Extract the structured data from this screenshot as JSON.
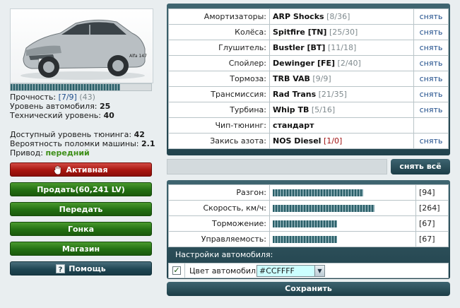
{
  "car": {
    "badge_text": "Alfa 147",
    "durability_label": "Прочность:",
    "durability_value": "[7/9]",
    "durability_extra": "(43)",
    "durability_fraction": 0.78,
    "level_label": "Уровень автомобиля:",
    "level_value": "25",
    "tech_label": "Технический уровень:",
    "tech_value": "40",
    "tuning_label": "Доступный уровень тюнинга:",
    "tuning_value": "42",
    "breakdown_label": "Вероятность поломки машины:",
    "breakdown_value": "2.1",
    "drive_label": "Привод:",
    "drive_value": "передний"
  },
  "actions": {
    "active_label": "Активная",
    "sell_label": "Продать(60,241 LV)",
    "transfer_label": "Передать",
    "race_label": "Гонка",
    "shop_label": "Магазин",
    "help_label": "Помощь"
  },
  "parts": [
    {
      "label": "Амортизаторы:",
      "name": "ARP Shocks",
      "level": "[8/36]",
      "action": "снять"
    },
    {
      "label": "Колёса:",
      "name": "Spitfire [TN]",
      "level": "[25/30]",
      "action": "снять"
    },
    {
      "label": "Глушитель:",
      "name": "Bustler [BT]",
      "level": "[11/18]",
      "action": "снять"
    },
    {
      "label": "Спойлер:",
      "name": "Dewinger [FE]",
      "level": "[2/40]",
      "action": "снять"
    },
    {
      "label": "Тормоза:",
      "name": "TRB VAB",
      "level": "[9/9]",
      "action": "снять"
    },
    {
      "label": "Трансмиссия:",
      "name": "Rad Trans",
      "level": "[21/35]",
      "action": "снять"
    },
    {
      "label": "Турбина:",
      "name": "Whip TB",
      "level": "[5/16]",
      "action": "снять"
    },
    {
      "label": "Чип-тюнинг:",
      "name": "стандарт",
      "level": "",
      "action": ""
    },
    {
      "label": "Закись азота:",
      "name": "NOS Diesel",
      "level": "[1/0]",
      "action": "снять"
    }
  ],
  "remove_all_label": "снять всё",
  "performance": [
    {
      "label": "Разгон:",
      "value": "[94]",
      "fraction": 0.645
    },
    {
      "label": "Скорость, км/ч:",
      "value": "[264]",
      "fraction": 0.725
    },
    {
      "label": "Торможение:",
      "value": "[67]",
      "fraction": 0.46
    },
    {
      "label": "Управляемость:",
      "value": "[67]",
      "fraction": 0.46
    }
  ],
  "settings": {
    "header": "Настройки автомобиля:",
    "color_checked": true,
    "color_label": "Цвет автомобиля:",
    "color_value": "#CCFFFF",
    "save_label": "Сохранить"
  },
  "colors": {
    "panel": "#2f5560",
    "active_red": "#b01a13",
    "action_green": "#2a7a18",
    "nav_teal": "#234a56",
    "bar": "#2a5f68",
    "drive_green": "#3e8f18",
    "link_blue": "#1d4c8a"
  },
  "icons": [
    "hand-icon",
    "help-icon",
    "chevron-down-icon",
    "checkmark-icon"
  ]
}
